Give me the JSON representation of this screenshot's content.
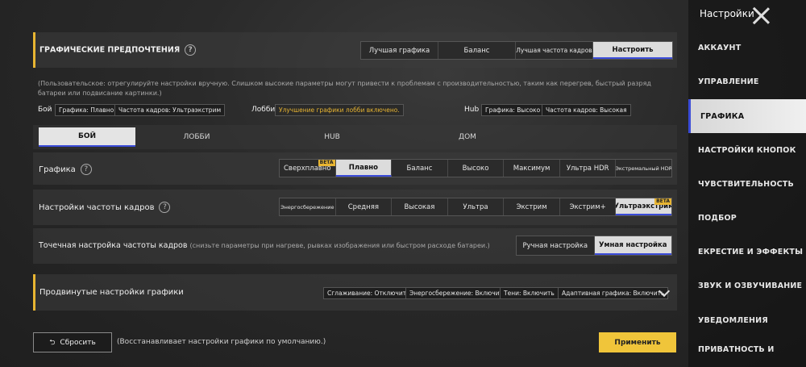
{
  "sidebar": {
    "title": "Настройки",
    "items": [
      {
        "label": "АККАУНТ"
      },
      {
        "label": "УПРАВЛЕНИЕ"
      },
      {
        "label": "ГРАФИКА",
        "active": true
      },
      {
        "label": "НАСТРОЙКИ КНОПОК"
      },
      {
        "label": "ЧУВСТВИТЕЛЬНОСТЬ"
      },
      {
        "label": "ПОДБОР"
      },
      {
        "label": "ЕКРЕСТИЕ И ЭФФЕКТЫ"
      },
      {
        "label": "ЗВУК И ОЗВУЧИВАНИЕ"
      },
      {
        "label": "УВЕДОМЛЕНИЯ"
      },
      {
        "label": "ПРИВАТНОСТЬ И"
      }
    ]
  },
  "prefs": {
    "title": "ГРАФИЧЕСКИЕ ПРЕДПОЧТЕНИЯ",
    "options": [
      "Лучшая графика",
      "Баланс",
      "Лучшая частота кадров",
      "Настроить"
    ],
    "selected": 3,
    "description": "(Пользовательское: отрегулируйте настройки вручную. Слишком высокие параметры могут привести к проблемам с производительностью, таким как перегрев, быстрый разряд батареи или подвисание картинки.)"
  },
  "summary": {
    "battle_label": "Бой",
    "battle_graphics": "Графика: Плавно",
    "battle_fps": "Частота кадров: Ультраэкстрим",
    "lobby_label": "Лобби",
    "lobby_value": "Улучшение графики лобби включено.",
    "hub_label": "Hub",
    "hub_graphics": "Графика: Высоко",
    "hub_fps": "Частота кадров: Высокая"
  },
  "tabs": [
    "БОЙ",
    "ЛОББИ",
    "HUB",
    "ДОМ"
  ],
  "graphics": {
    "label": "Графика",
    "options": [
      "Сверхплавно",
      "Плавно",
      "Баланс",
      "Высоко",
      "Максимум",
      "Ультра HDR",
      "Экстремальный HDR"
    ],
    "selected": 1,
    "beta_badge": "BETA"
  },
  "fps": {
    "label": "Настройки частоты кадров",
    "options": [
      "Энергосбережение",
      "Средняя",
      "Высокая",
      "Ультра",
      "Экстрим",
      "Экстрим+",
      "Ультраэкстрим"
    ],
    "selected": 6,
    "beta_badge": "BETA"
  },
  "fine_fps": {
    "label": "Точечная настройка частоты кадров",
    "hint": "(снизьте параметры при нагреве, рывках изображения или быстром расходе батареи.)",
    "options": [
      "Ручная настройка",
      "Умная настройка"
    ],
    "selected": 1
  },
  "advanced": {
    "title": "Продвинутые настройки графики",
    "tags": [
      "Сглаживание: Отключить",
      "Энергосбережение: Включить",
      "Тени: Включить",
      "Адаптивная графика: Включить"
    ]
  },
  "footer": {
    "reset_label": "Сбросить",
    "reset_hint": "(Восстанавливает настройки графики по умолчанию.)",
    "apply_label": "Применить"
  },
  "colors": {
    "accent": "#e8b532",
    "selected_underline": "#3a4bd8",
    "apply": "#f0c53a"
  }
}
